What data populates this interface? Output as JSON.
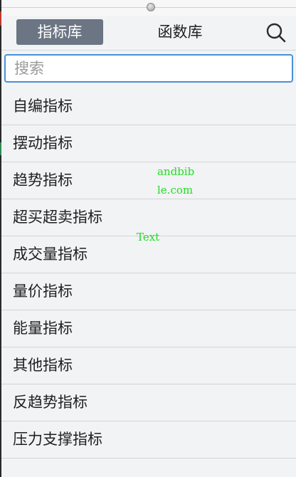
{
  "tabs": [
    {
      "label": "指标库",
      "active": true
    },
    {
      "label": "函数库",
      "active": false
    }
  ],
  "search": {
    "placeholder": "搜索",
    "value": ""
  },
  "icons": {
    "search": "search-icon"
  },
  "categories": [
    "自编指标",
    "摆动指标",
    "趋势指标",
    "超买超卖指标",
    "成交量指标",
    "量价指标",
    "能量指标",
    "其他指标",
    "反趋势指标",
    "压力支撑指标"
  ],
  "watermark": {
    "line1": "andbib",
    "line2": "le.com",
    "text": "Text"
  },
  "colors": {
    "accent": "#6b7583",
    "input_border": "#4a90d9",
    "watermark": "#22dd22",
    "background": "#f1f3f4"
  }
}
